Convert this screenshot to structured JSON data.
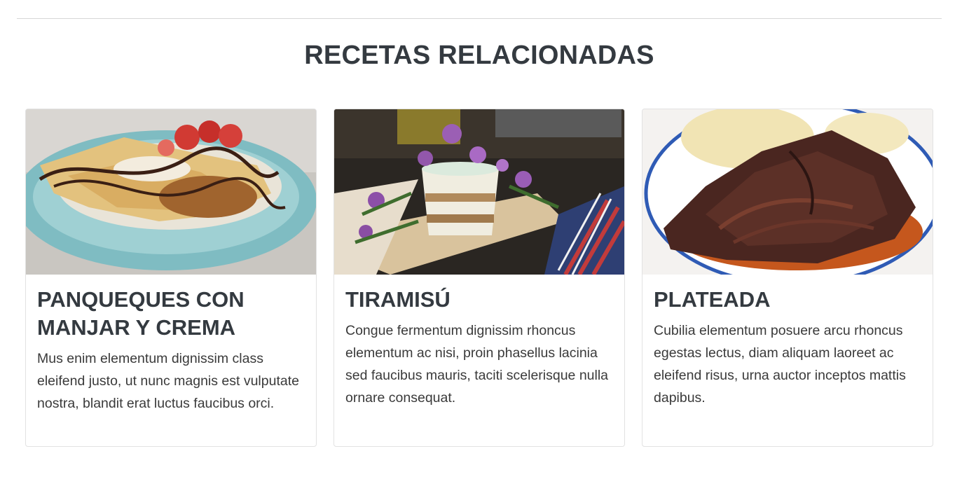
{
  "section": {
    "title": "RECETAS RELACIONADAS"
  },
  "recipes": [
    {
      "title": "PANQUEQUES CON MANJAR Y CREMA",
      "description": "Mus enim elementum dignissim class eleifend justo, ut nunc magnis est vulputate nostra, blandit erat luctus faucibus orci.",
      "image": "crepes-photo"
    },
    {
      "title": "TIRAMISÚ",
      "description": "Congue fermentum dignissim rhoncus elementum ac nisi, proin phasellus lacinia sed faucibus mauris, taciti scelerisque nulla ornare consequat.",
      "image": "tiramisu-photo"
    },
    {
      "title": "PLATEADA",
      "description": "Cubilia elementum posuere arcu rhoncus egestas lectus, diam aliquam laoreet ac eleifend risus, urna auctor inceptos mattis dapibus.",
      "image": "plateada-photo"
    }
  ]
}
